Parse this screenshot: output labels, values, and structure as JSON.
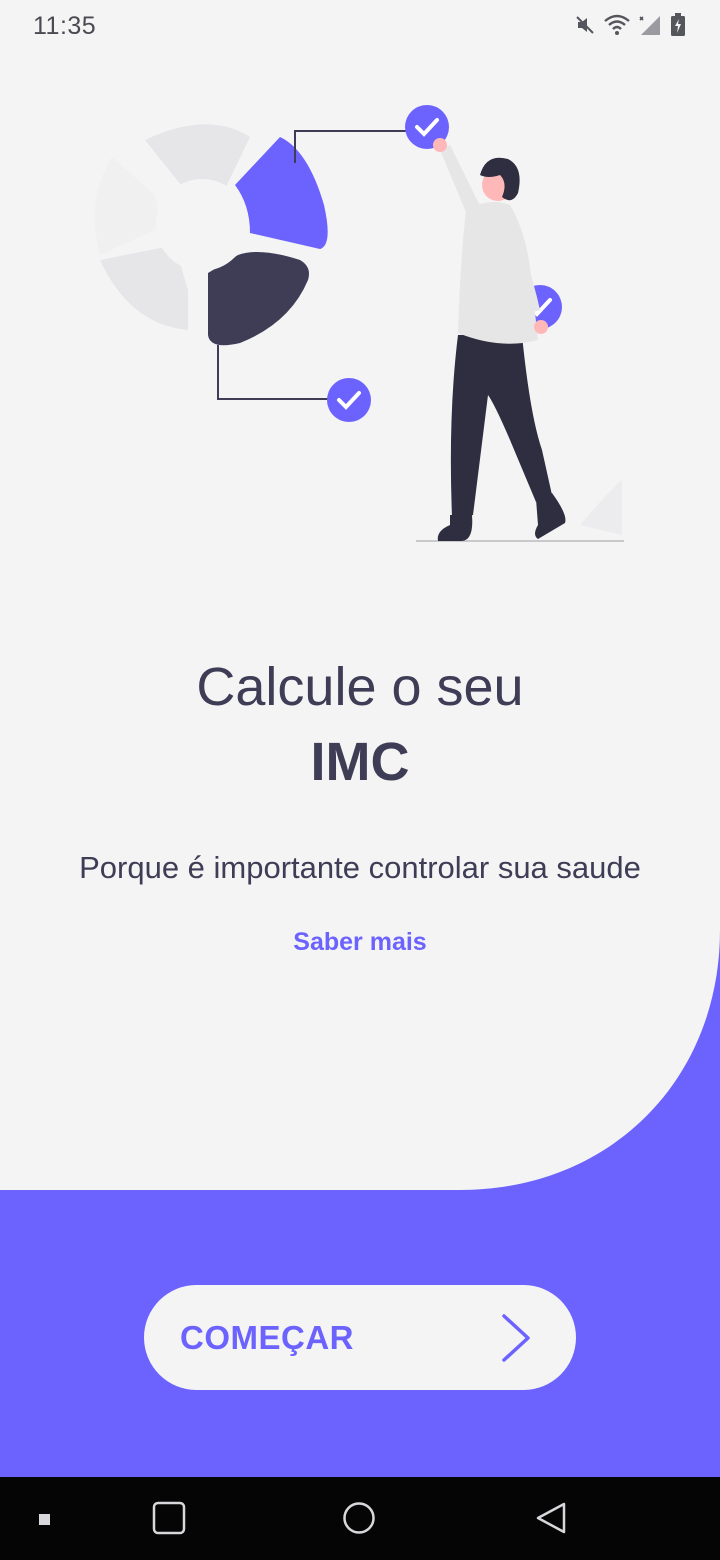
{
  "status_bar": {
    "time": "11:35",
    "icons": [
      "mute-icon",
      "wifi-icon",
      "signal-icon",
      "battery-icon"
    ]
  },
  "main": {
    "headline_line1": "Calcule o seu",
    "headline_line2": "IMC",
    "subtitle": "Porque é importante controlar sua saude",
    "learn_more_label": "Saber mais",
    "start_button_label": "COMEÇAR"
  },
  "colors": {
    "accent": "#6c63ff",
    "text_dark": "#3f3d56",
    "background": "#f4f4f5",
    "nav_bar": "#050505"
  },
  "nav_bar": {
    "buttons": [
      "recents-dot-icon",
      "square-icon",
      "home-circle-icon",
      "back-triangle-icon"
    ]
  }
}
